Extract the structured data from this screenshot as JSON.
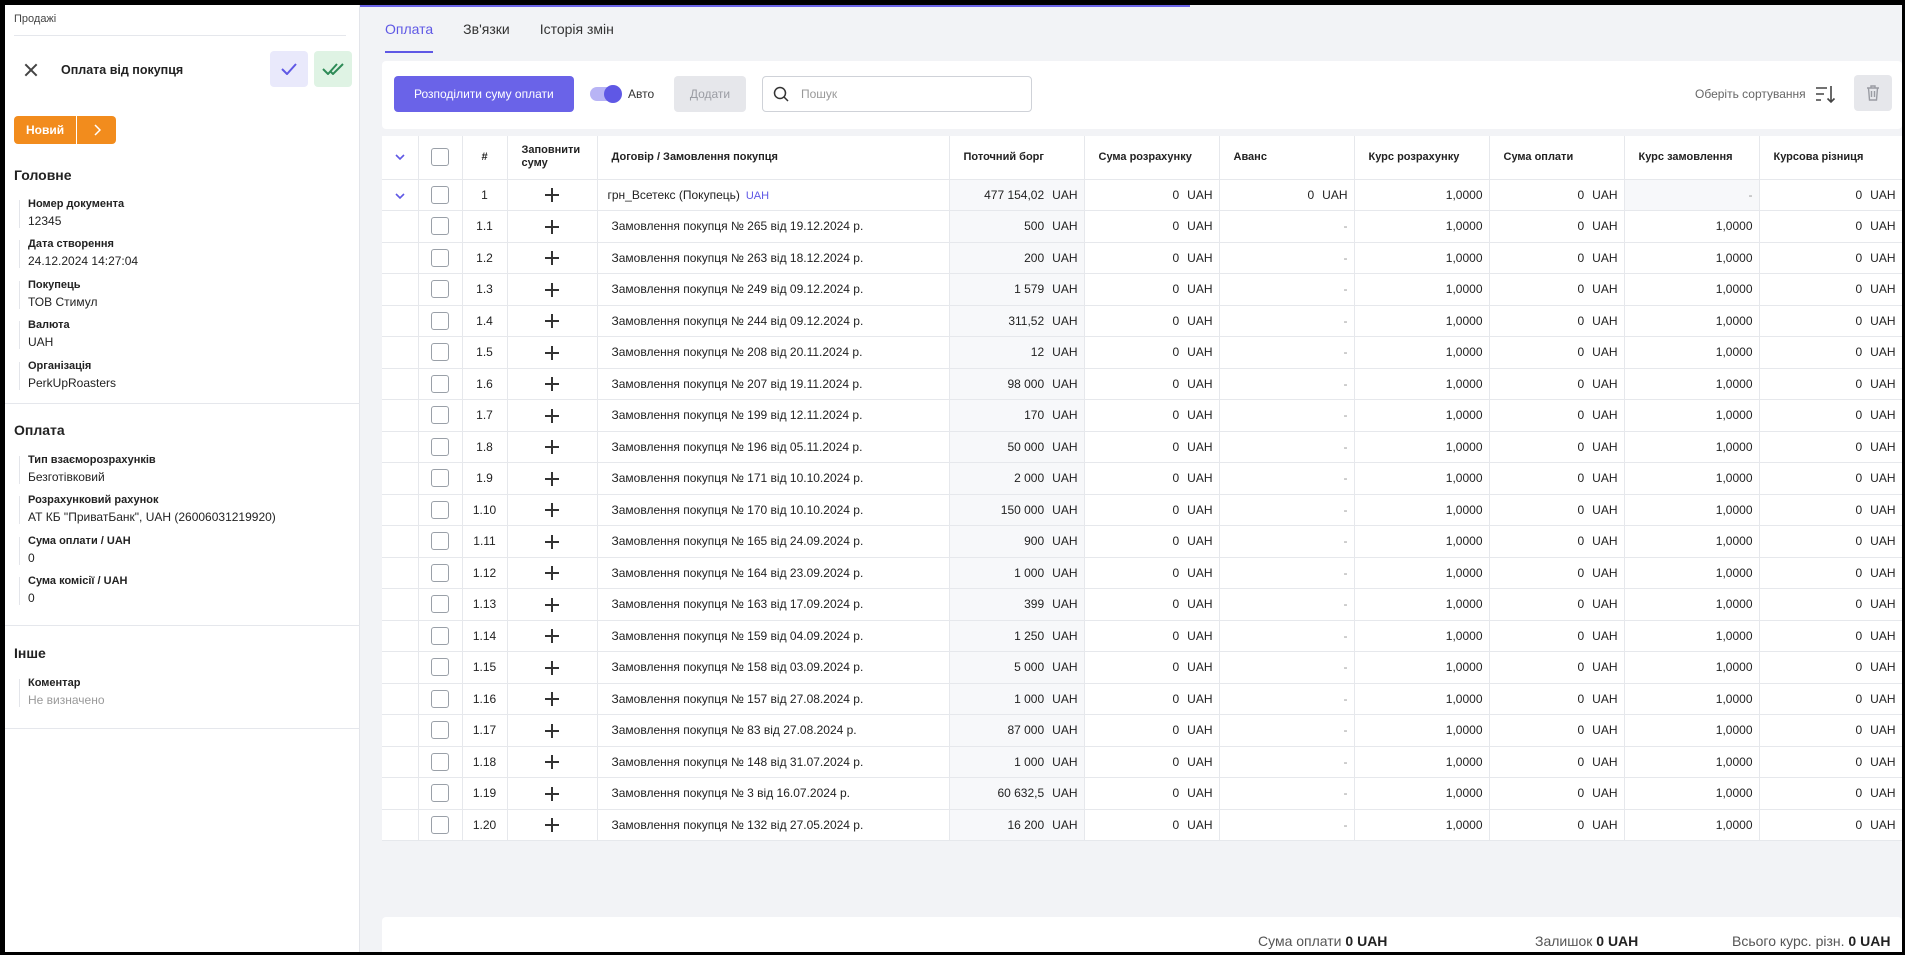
{
  "breadcrumb": "Продажі",
  "document_title": "Оплата від покупця",
  "status": {
    "label": "Новий"
  },
  "sections": {
    "main": {
      "title": "Головне",
      "fields": [
        {
          "label": "Номер документа",
          "value": "12345"
        },
        {
          "label": "Дата створення",
          "value": "24.12.2024 14:27:04"
        },
        {
          "label": "Покупець",
          "value": "ТОВ Стимул"
        },
        {
          "label": "Валюта",
          "value": "UAH"
        },
        {
          "label": "Організація",
          "value": "PerkUpRoasters"
        }
      ]
    },
    "payment": {
      "title": "Оплата",
      "fields": [
        {
          "label": "Тип взаєморозрахунків",
          "value": "Безготівковий"
        },
        {
          "label": "Розрахунковий рахунок",
          "value": "АТ КБ \"ПриватБанк\", UAH (26006031219920)"
        },
        {
          "label": "Сума оплати / UAH",
          "value": "0"
        },
        {
          "label": "Сума комісії / UAH",
          "value": "0"
        }
      ]
    },
    "other": {
      "title": "Інше",
      "fields": [
        {
          "label": "Коментар",
          "value": "Не визначено"
        }
      ]
    }
  },
  "tabs": [
    {
      "label": "Оплата",
      "active": true
    },
    {
      "label": "Зв'язки",
      "active": false
    },
    {
      "label": "Історія змін",
      "active": false
    }
  ],
  "toolbar": {
    "distribute_label": "Розподілити суму оплати",
    "auto_label": "Авто",
    "auto_on": true,
    "add_label": "Додати",
    "search_placeholder": "Пошук",
    "sort_label": "Оберіть сортування"
  },
  "table": {
    "headers": {
      "num": "#",
      "fill": "Заповнити суму",
      "contract": "Договір / Замовлення покупця",
      "debt": "Поточний борг",
      "calc_sum": "Сума розрахунку",
      "advance": "Аванс",
      "calc_rate": "Курс розрахунку",
      "pay_sum": "Сума оплати",
      "order_rate": "Курс замовлення",
      "rate_diff": "Курсова різниця"
    },
    "group": {
      "num": "1",
      "contract": "грн_Всетекс (Покупець)",
      "contract_currency": "UAH",
      "debt": "477 154,02",
      "calc_sum": "0",
      "advance": "0",
      "calc_rate": "1,0000",
      "pay_sum": "0",
      "order_rate": "-",
      "rate_diff": "0",
      "currency": "UAH"
    },
    "rows": [
      {
        "num": "1.1",
        "contract": "Замовлення покупця № 265 від 19.12.2024 р.",
        "debt": "500"
      },
      {
        "num": "1.2",
        "contract": "Замовлення покупця № 263 від 18.12.2024 р.",
        "debt": "200"
      },
      {
        "num": "1.3",
        "contract": "Замовлення покупця № 249 від 09.12.2024 р.",
        "debt": "1 579"
      },
      {
        "num": "1.4",
        "contract": "Замовлення покупця № 244 від 09.12.2024 р.",
        "debt": "311,52"
      },
      {
        "num": "1.5",
        "contract": "Замовлення покупця № 208 від 20.11.2024 р.",
        "debt": "12"
      },
      {
        "num": "1.6",
        "contract": "Замовлення покупця № 207 від 19.11.2024 р.",
        "debt": "98 000"
      },
      {
        "num": "1.7",
        "contract": "Замовлення покупця № 199 від 12.11.2024 р.",
        "debt": "170"
      },
      {
        "num": "1.8",
        "contract": "Замовлення покупця № 196 від 05.11.2024 р.",
        "debt": "50 000"
      },
      {
        "num": "1.9",
        "contract": "Замовлення покупця № 171 від 10.10.2024 р.",
        "debt": "2 000"
      },
      {
        "num": "1.10",
        "contract": "Замовлення покупця № 170 від 10.10.2024 р.",
        "debt": "150 000"
      },
      {
        "num": "1.11",
        "contract": "Замовлення покупця № 165 від 24.09.2024 р.",
        "debt": "900"
      },
      {
        "num": "1.12",
        "contract": "Замовлення покупця № 164 від 23.09.2024 р.",
        "debt": "1 000"
      },
      {
        "num": "1.13",
        "contract": "Замовлення покупця № 163 від 17.09.2024 р.",
        "debt": "399"
      },
      {
        "num": "1.14",
        "contract": "Замовлення покупця № 159 від 04.09.2024 р.",
        "debt": "1 250"
      },
      {
        "num": "1.15",
        "contract": "Замовлення покупця № 158 від 03.09.2024 р.",
        "debt": "5 000"
      },
      {
        "num": "1.16",
        "contract": "Замовлення покупця № 157 від 27.08.2024 р.",
        "debt": "1 000"
      },
      {
        "num": "1.17",
        "contract": "Замовлення покупця № 83 від 27.08.2024 р.",
        "debt": "87 000"
      },
      {
        "num": "1.18",
        "contract": "Замовлення покупця № 148 від 31.07.2024 р.",
        "debt": "1 000"
      },
      {
        "num": "1.19",
        "contract": "Замовлення покупця № 3 від 16.07.2024 р.",
        "debt": "60 632,5"
      },
      {
        "num": "1.20",
        "contract": "Замовлення покупця № 132 від 27.05.2024 р.",
        "debt": "16 200"
      }
    ],
    "row_defaults": {
      "currency": "UAH",
      "calc_sum": "0",
      "advance": "-",
      "calc_rate": "1,0000",
      "pay_sum": "0",
      "order_rate": "1,0000",
      "rate_diff": "0"
    }
  },
  "footer": {
    "pay_sum_label": "Сума оплати",
    "pay_sum_value": "0 UAH",
    "remainder_label": "Залишок",
    "remainder_value": "0 UAH",
    "total_diff_label": "Всього курс. різн.",
    "total_diff_value": "0 UAH"
  },
  "colors": {
    "accent": "#6a63e8",
    "status_new": "#f28c1d",
    "confirm_bg": "#e9e9fb",
    "confirm_all_bg": "#dff3e4"
  },
  "icons": [
    "close-icon",
    "check-icon",
    "double-check-icon",
    "chevron-right-icon",
    "search-icon",
    "sort-icon",
    "trash-icon",
    "chevron-down-icon",
    "plus-icon"
  ]
}
